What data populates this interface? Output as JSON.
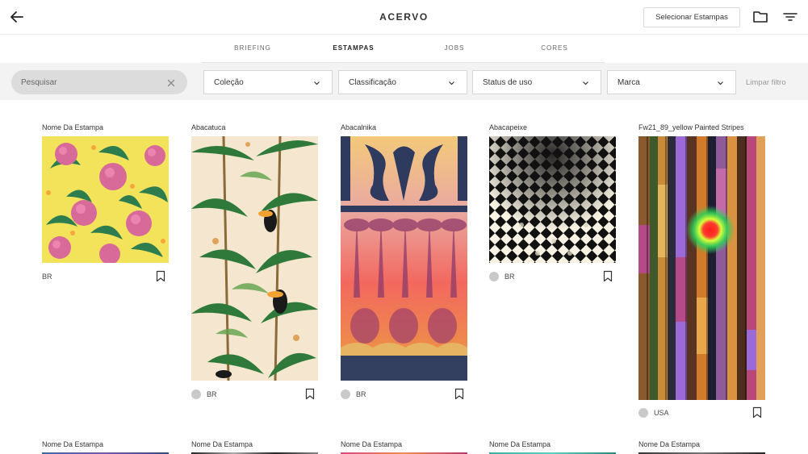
{
  "header": {
    "title": "ACERVO",
    "select_label": "Selecionar Estampas"
  },
  "tabs": [
    {
      "label": "BRIEFING",
      "active": false
    },
    {
      "label": "ESTAMPAS",
      "active": true
    },
    {
      "label": "JOBS",
      "active": false
    },
    {
      "label": "CORES",
      "active": false
    }
  ],
  "filters": {
    "search_placeholder": "Pesquisar",
    "dropdowns": [
      "Coleção",
      "Classificação",
      "Status de uso",
      "Marca"
    ],
    "clear_label": "Limpar filtro"
  },
  "cards": [
    {
      "title": "Nome Da Estampa",
      "region": "BR",
      "has_dot": false,
      "pattern": "pineapple"
    },
    {
      "title": "Abacatuca",
      "region": "BR",
      "has_dot": true,
      "pattern": "tropical"
    },
    {
      "title": "Abacalnika",
      "region": "BR",
      "has_dot": true,
      "pattern": "ornament"
    },
    {
      "title": "Abacapeixe",
      "region": "BR",
      "has_dot": true,
      "pattern": "checker"
    },
    {
      "title": "Fw21_89_yellow Painted Stripes",
      "region": "USA",
      "has_dot": true,
      "pattern": "stripes"
    }
  ],
  "next_row_titles": [
    "Nome Da Estampa",
    "Nome Da Estampa",
    "Nome Da Estampa",
    "Nome Da Estampa",
    "Nome Da Estampa"
  ],
  "colors": {
    "accent": "#222222",
    "filter_bg": "#f3f3f3",
    "search_bg": "#dcdcdc",
    "muted": "#9a9a9a"
  },
  "icons": {
    "back": "arrow-left-icon",
    "folder": "folder-icon",
    "filter": "filter-lines-icon",
    "clear": "close-icon",
    "chevron": "chevron-down-icon",
    "bookmark": "bookmark-icon"
  }
}
